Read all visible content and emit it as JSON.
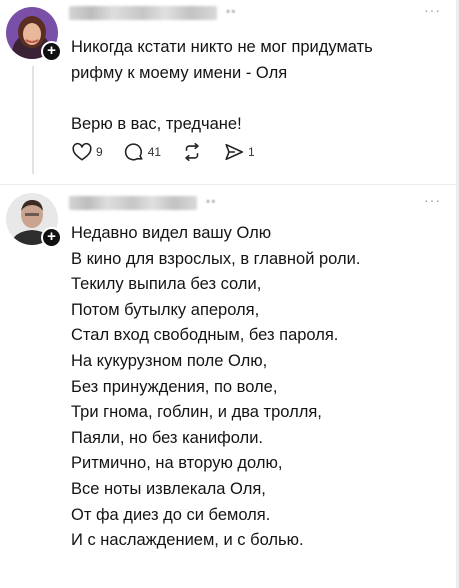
{
  "comments": [
    {
      "more_label": "···",
      "lines": [
        "Никогда кстати никто не мог придумать",
        "рифму к моему имени - Оля",
        "",
        "Верю в вас, тредчане!"
      ],
      "actions": {
        "likes": "9",
        "replies": "41",
        "reposts": "",
        "shares": "1"
      }
    },
    {
      "more_label": "···",
      "lines": [
        "Недавно видел вашу Олю",
        "В кино для взрослых, в главной роли.",
        "Текилу выпила без соли,",
        "Потом бутылку апероля,",
        "Стал вход свободным, без пароля.",
        "На кукурузном поле Олю,",
        "Без принуждения, по воле,",
        "Три гнома, гоблин, и два тролля,",
        "Паяли, но без канифоли.",
        "Ритмично, на вторую долю,",
        "Все ноты извлекала Оля,",
        "От фа диез до си бемоля.",
        "И с наслаждением, и с болью."
      ]
    }
  ],
  "icons": {
    "like": "heart-icon",
    "reply": "comment-icon",
    "repost": "repost-icon",
    "share": "send-icon",
    "follow": "plus-icon"
  },
  "colors": {
    "text": "#141414",
    "muted": "#bdbdbd",
    "thread_line": "#e3e3e3"
  }
}
